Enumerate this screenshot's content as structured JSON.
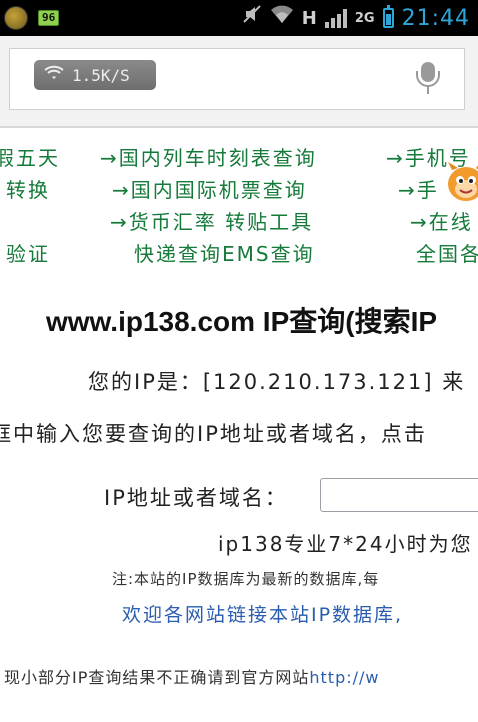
{
  "status_bar": {
    "battery_badge": "96",
    "network_type": "H",
    "data_label": "2G",
    "time": "21:44",
    "icons": [
      "app-icon",
      "battery-level-badge",
      "mute-icon",
      "wifi-icon",
      "signal-icon",
      "battery-icon"
    ]
  },
  "address_bar": {
    "speed": "1.5K/S",
    "icons": [
      "wifi-icon",
      "microphone-icon"
    ]
  },
  "links_row1": {
    "col1": "假五天",
    "col2": "→国内列车时刻表查询",
    "col3": "→手机号"
  },
  "links_row2": {
    "col1": "转换",
    "col2": "→国内国际机票查询",
    "col3": "→手"
  },
  "links_row3": {
    "col2": "→货币汇率 转贴工具",
    "col3": "→在线"
  },
  "links_row4": {
    "col1": "验证",
    "col2": "快递查询EMS查询",
    "col3": "全国各"
  },
  "main": {
    "title": "www.ip138.com IP查询(搜索IP",
    "your_ip_line": "您的IP是：[120.210.173.121] 来",
    "instruction": "框中输入您要查询的IP地址或者域名，点击",
    "input_label": "IP地址或者域名：",
    "service_note": "ip138专业7*24小时为您",
    "db_note": "注:本站的IP数据库为最新的数据库,每",
    "welcome": "欢迎各网站链接本站IP数据库,",
    "bottom_note": "现小部分IP查询结果不正确请到官方网站",
    "bottom_link": "http://w"
  }
}
